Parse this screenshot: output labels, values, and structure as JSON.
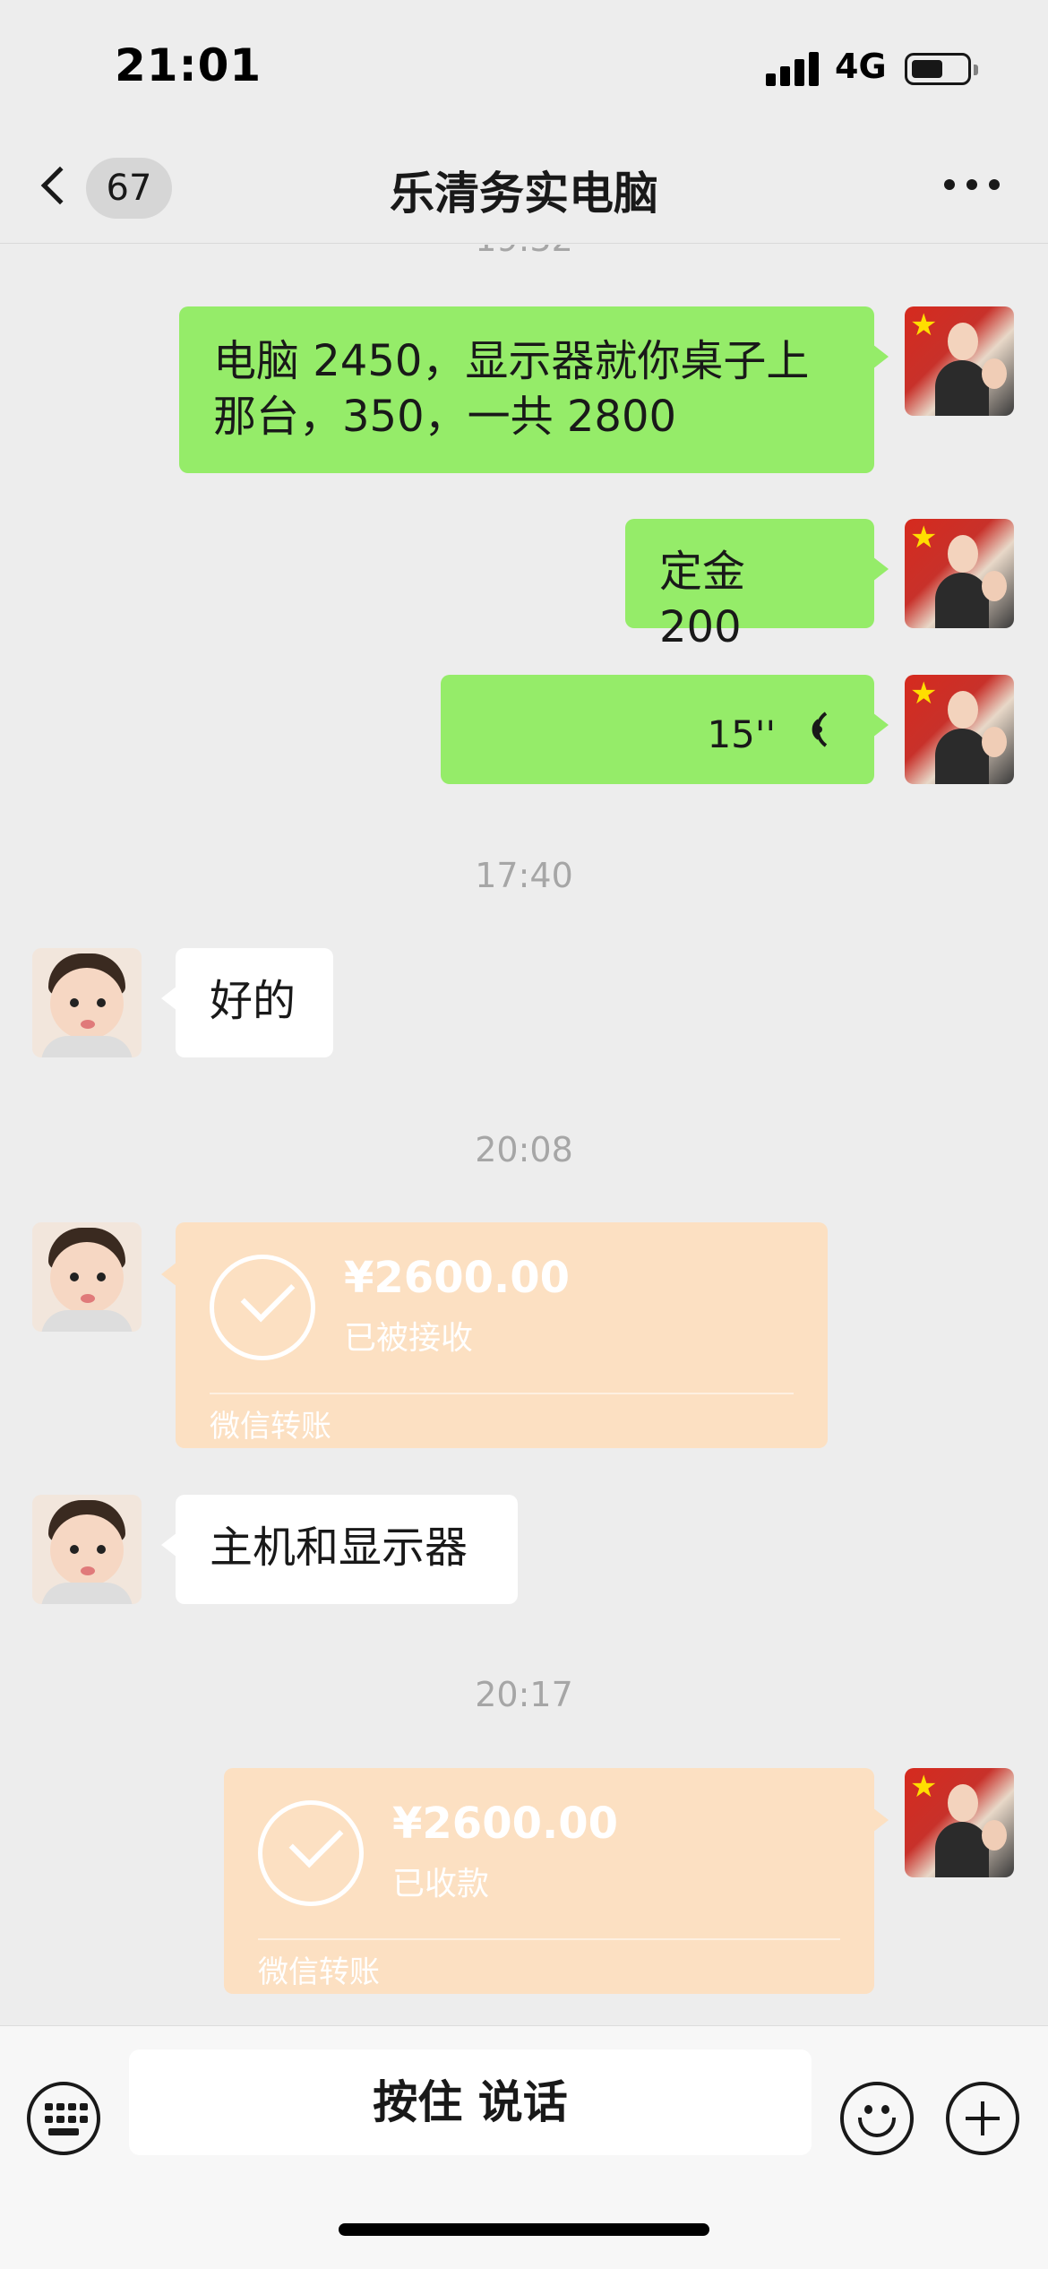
{
  "status_bar": {
    "time": "21:01",
    "network": "4G"
  },
  "nav": {
    "unread_count": "67",
    "title": "乐清务实电脑"
  },
  "messages": [
    {
      "type": "text",
      "sender": "me",
      "text": "电脑 2450，显示器就你桌子上那台，350，一共 2800"
    },
    {
      "type": "text",
      "sender": "me",
      "text": "定金 200"
    },
    {
      "type": "voice",
      "sender": "me",
      "duration": "15''"
    },
    {
      "type": "timestamp",
      "text": "17:40"
    },
    {
      "type": "text",
      "sender": "them",
      "text": "好的"
    },
    {
      "type": "timestamp",
      "text": "20:08"
    },
    {
      "type": "transfer",
      "sender": "them",
      "amount": "¥2600.00",
      "status": "已被接收",
      "source": "微信转账"
    },
    {
      "type": "text",
      "sender": "them",
      "text": "主机和显示器"
    },
    {
      "type": "timestamp",
      "text": "20:17"
    },
    {
      "type": "transfer",
      "sender": "me",
      "amount": "¥2600.00",
      "status": "已收款",
      "source": "微信转账"
    }
  ],
  "input_bar": {
    "hold_to_talk": "按住 说话"
  },
  "colors": {
    "background": "#ededed",
    "bubble_me": "#95ec69",
    "bubble_them": "#ffffff",
    "transfer": "#fce0c2"
  }
}
